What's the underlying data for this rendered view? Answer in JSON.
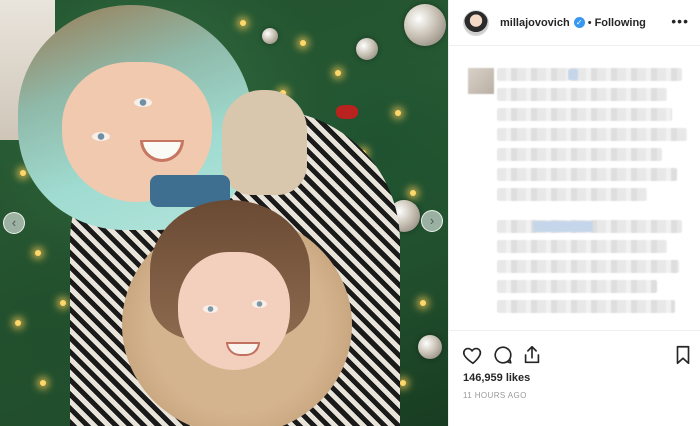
{
  "post": {
    "header": {
      "username": "millajovovich",
      "verified_mark": "✓",
      "separator": "•",
      "follow_status": "Following",
      "more_icon": "more-horizontal-icon"
    },
    "engagement": {
      "likes": "146,959 likes",
      "timestamp": "11 HOURS AGO"
    },
    "actions": [
      "like-heart-icon",
      "comment-bubble-icon",
      "share-icon",
      "bookmark-icon"
    ],
    "carousel": {
      "prev_icon": "‹",
      "next_icon": "›"
    }
  },
  "colors": {
    "verified_badge": "#3897f0",
    "text_primary": "#262626",
    "text_secondary": "#999999",
    "divider": "#efefef"
  }
}
